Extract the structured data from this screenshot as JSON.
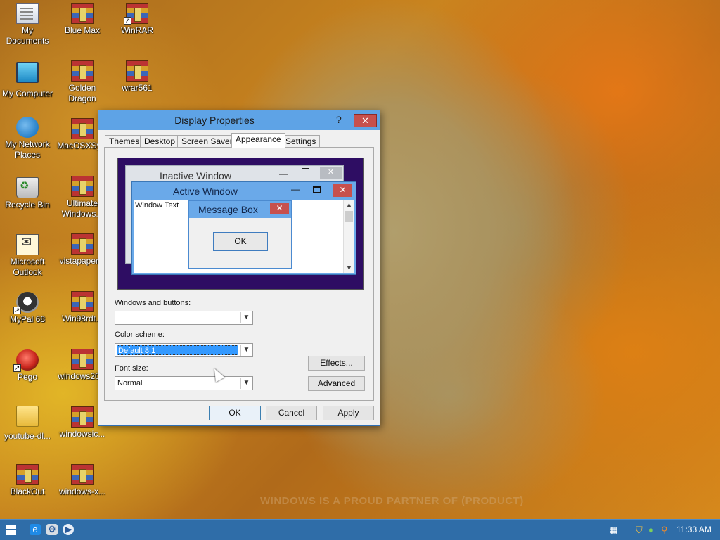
{
  "desktop": {
    "icons": [
      {
        "label": "My Documents",
        "icon": "documents-icon"
      },
      {
        "label": "Blue Max",
        "icon": "winrar-archive-icon"
      },
      {
        "label": "WinRAR",
        "icon": "winrar-shortcut-icon"
      },
      {
        "label": "My Computer",
        "icon": "computer-icon"
      },
      {
        "label": "Golden Dragon",
        "icon": "winrar-archive-icon"
      },
      {
        "label": "wrar561",
        "icon": "winrar-archive-icon"
      },
      {
        "label": "My Network Places",
        "icon": "network-icon"
      },
      {
        "label": "MacOSXSy...",
        "icon": "winrar-archive-icon"
      },
      {
        "label": "Recycle Bin",
        "icon": "recycle-bin-icon"
      },
      {
        "label": "Ultimate Windows...",
        "icon": "winrar-archive-icon"
      },
      {
        "label": "Microsoft Outlook",
        "icon": "outlook-icon"
      },
      {
        "label": "vistapaper...",
        "icon": "winrar-archive-icon"
      },
      {
        "label": "MyPal 68",
        "icon": "mypal-icon"
      },
      {
        "label": "Win98rdt...",
        "icon": "winrar-archive-icon"
      },
      {
        "label": "Pego",
        "icon": "pego-icon"
      },
      {
        "label": "windows20...",
        "icon": "winrar-archive-icon"
      },
      {
        "label": "youtube-dl...",
        "icon": "folder-icon"
      },
      {
        "label": "windowsic...",
        "icon": "winrar-archive-icon"
      },
      {
        "label": "BlackOut",
        "icon": "winrar-archive-icon"
      },
      {
        "label": "windows-x...",
        "icon": "winrar-archive-icon"
      }
    ],
    "watermark": "WINDOWS IS A PROUD PARTNER OF (PRODUCT)"
  },
  "dialog": {
    "title": "Display Properties",
    "help_glyph": "?",
    "close_glyph": "✕",
    "tabs": [
      "Themes",
      "Desktop",
      "Screen Saver",
      "Appearance",
      "Settings"
    ],
    "active_tab": "Appearance",
    "preview": {
      "inactive_title": "Inactive Window",
      "active_title": "Active Window",
      "window_text": "Window Text",
      "message_box_title": "Message Box",
      "message_box_ok": "OK"
    },
    "windows_buttons_label": "Windows and buttons:",
    "windows_buttons_value": "",
    "color_scheme_label": "Color scheme:",
    "color_scheme_value": "Default 8.1",
    "font_size_label": "Font size:",
    "font_size_value": "Normal",
    "effects_button": "Effects...",
    "advanced_button": "Advanced",
    "ok_button": "OK",
    "cancel_button": "Cancel",
    "apply_button": "Apply"
  },
  "taskbar": {
    "clock": "11:33 AM"
  },
  "colors": {
    "titlebar": "#5ea3e6",
    "close_button": "#c7504d",
    "taskbar": "#2f6da8",
    "preview_desktop": "#2e0d63",
    "selection": "#3399ff"
  }
}
